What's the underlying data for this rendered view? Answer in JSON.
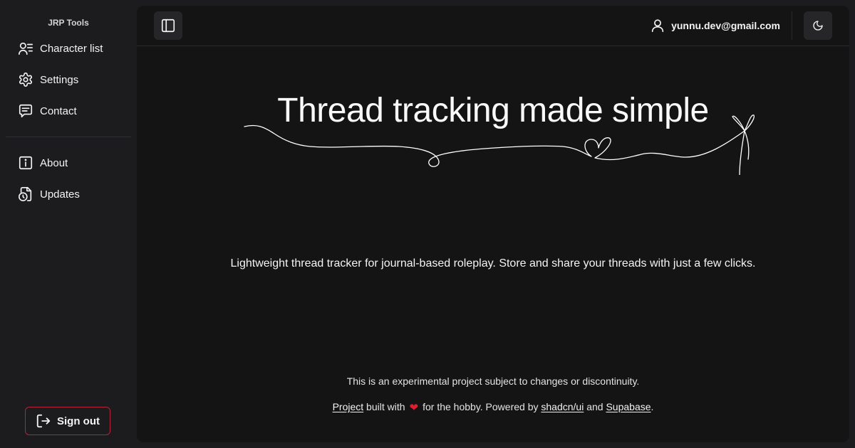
{
  "sidebar": {
    "brand": "JRP Tools",
    "items": [
      {
        "label": "Character list",
        "icon": "users-list-icon"
      },
      {
        "label": "Settings",
        "icon": "gear-icon"
      },
      {
        "label": "Contact",
        "icon": "message-icon"
      },
      {
        "label": "About",
        "icon": "info-icon"
      },
      {
        "label": "Updates",
        "icon": "file-clock-icon"
      }
    ],
    "sign_out_label": "Sign out"
  },
  "header": {
    "user_email": "yunnu.dev@gmail.com"
  },
  "hero": {
    "title": "Thread tracking made simple",
    "tagline": "Lightweight thread tracker for journal-based roleplay. Store and share your threads with just a few clicks."
  },
  "footer": {
    "note": "This is an experimental project subject to changes or discontinuity.",
    "project_link": "Project",
    "built_with": "built with",
    "for_hobby": "for the hobby. Powered by",
    "shadcn_link": "shadcn/ui",
    "and": "and",
    "supabase_link": "Supabase",
    "period": "."
  },
  "colors": {
    "sidebar_bg": "#1c1c1e",
    "main_bg": "#141414",
    "signout_border": "#b3243a",
    "heart": "#e11d2e"
  }
}
